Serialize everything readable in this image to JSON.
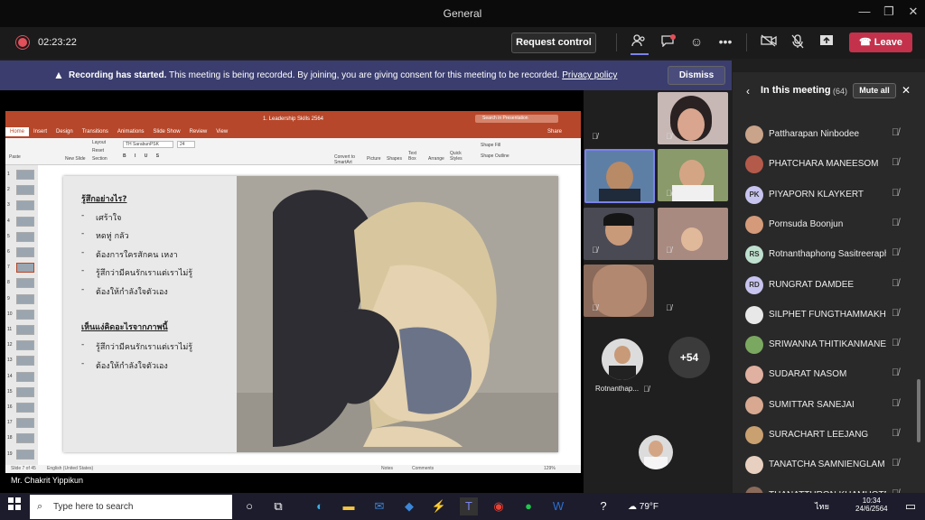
{
  "window": {
    "title": "General"
  },
  "toolbar": {
    "timer": "02:23:22",
    "request_control": "Request control",
    "leave": "Leave"
  },
  "banner": {
    "bold": "Recording has started.",
    "text": "This meeting is being recorded. By joining, you are giving consent for this meeting to be recorded.",
    "link": "Privacy policy",
    "dismiss": "Dismiss"
  },
  "ppt": {
    "title": "1. Leadership Skills 2564",
    "search": "Search in Presentation",
    "share": "Share",
    "tabs": [
      "Home",
      "Insert",
      "Design",
      "Transitions",
      "Animations",
      "Slide Show",
      "Review",
      "View"
    ],
    "font": "TH SarabunPSK",
    "size": "24",
    "ribbon": {
      "paste": "Paste",
      "new_slide": "New Slide",
      "layout": "Layout",
      "reset": "Reset",
      "section": "Section",
      "picture": "Picture",
      "shapes": "Shapes",
      "textbox": "Text Box",
      "arrange": "Arrange",
      "quick_styles": "Quick Styles",
      "shape_fill": "Shape Fill",
      "shape_outline": "Shape Outline",
      "smartart": "Convert to SmartArt"
    },
    "status": {
      "slide": "Slide 7 of 45",
      "lang": "English (United States)",
      "notes": "Notes",
      "comments": "Comments",
      "zoom": "129%"
    },
    "thumb_numbers": [
      "1",
      "2",
      "3",
      "4",
      "5",
      "6",
      "7",
      "8",
      "9",
      "10",
      "11",
      "12",
      "13",
      "14",
      "15",
      "16",
      "17",
      "18",
      "19"
    ],
    "slide": {
      "heading1": "รู้สึกอย่างไร?",
      "list1": [
        "เศร้าใจ",
        "หดหู่ กลัว",
        "ต้องการใครสักคน เหงา",
        "รู้สึกว่ามีคนรักเราแต่เราไม่รู้",
        "ต้องให้กำลังใจตัวเอง"
      ],
      "heading2": "เห็นแง่คิดอะไรจากภาพนี้",
      "list2": [
        "รู้สึกว่ามีคนรักเราแต่เราไม่รู้",
        "ต้องให้กำลังใจตัวเอง"
      ]
    }
  },
  "presenter": "Mr. Chakrit Yippikun",
  "grid": {
    "overflow": "+54",
    "tile_label": "Rotnanthap..."
  },
  "panel": {
    "title": "In this meeting",
    "count": "(64)",
    "mute_all": "Mute all",
    "participants": [
      {
        "name": "Pattharapan Ninbodee",
        "initials": "",
        "color": "#c9a48a"
      },
      {
        "name": "PHATCHARA MANEESOM",
        "initials": "",
        "color": "#b45a4a"
      },
      {
        "name": "PIYAPORN KLAYKERT",
        "initials": "PK",
        "color": "#c8c4f0"
      },
      {
        "name": "Pornsuda Boonjun",
        "initials": "",
        "color": "#d49a7a"
      },
      {
        "name": "Rotnanthaphong Sasitreeraph...",
        "initials": "RS",
        "color": "#bfe0cf"
      },
      {
        "name": "RUNGRAT DAMDEE",
        "initials": "RD",
        "color": "#c8c4f0"
      },
      {
        "name": "SILPHET FUNGTHAMMAKHUN",
        "initials": "",
        "color": "#e8e8e8"
      },
      {
        "name": "SRIWANNA THITIKANMANEE",
        "initials": "",
        "color": "#7aa860"
      },
      {
        "name": "SUDARAT NASOM",
        "initials": "",
        "color": "#e0b0a0"
      },
      {
        "name": "SUMITTAR SANEJAI",
        "initials": "",
        "color": "#d8a890"
      },
      {
        "name": "SURACHART LEEJANG",
        "initials": "",
        "color": "#c9a070"
      },
      {
        "name": "TANATCHA SAMNIENGLAM",
        "initials": "",
        "color": "#e8d0c0"
      },
      {
        "name": "THANATTHRON KHAMHOTRA",
        "initials": "",
        "color": "#8a6a5a"
      }
    ]
  },
  "taskbar": {
    "search": "Type here to search",
    "weather": "79°F",
    "time": "10:34",
    "date": "24/6/2564",
    "lang": "ไทย"
  }
}
